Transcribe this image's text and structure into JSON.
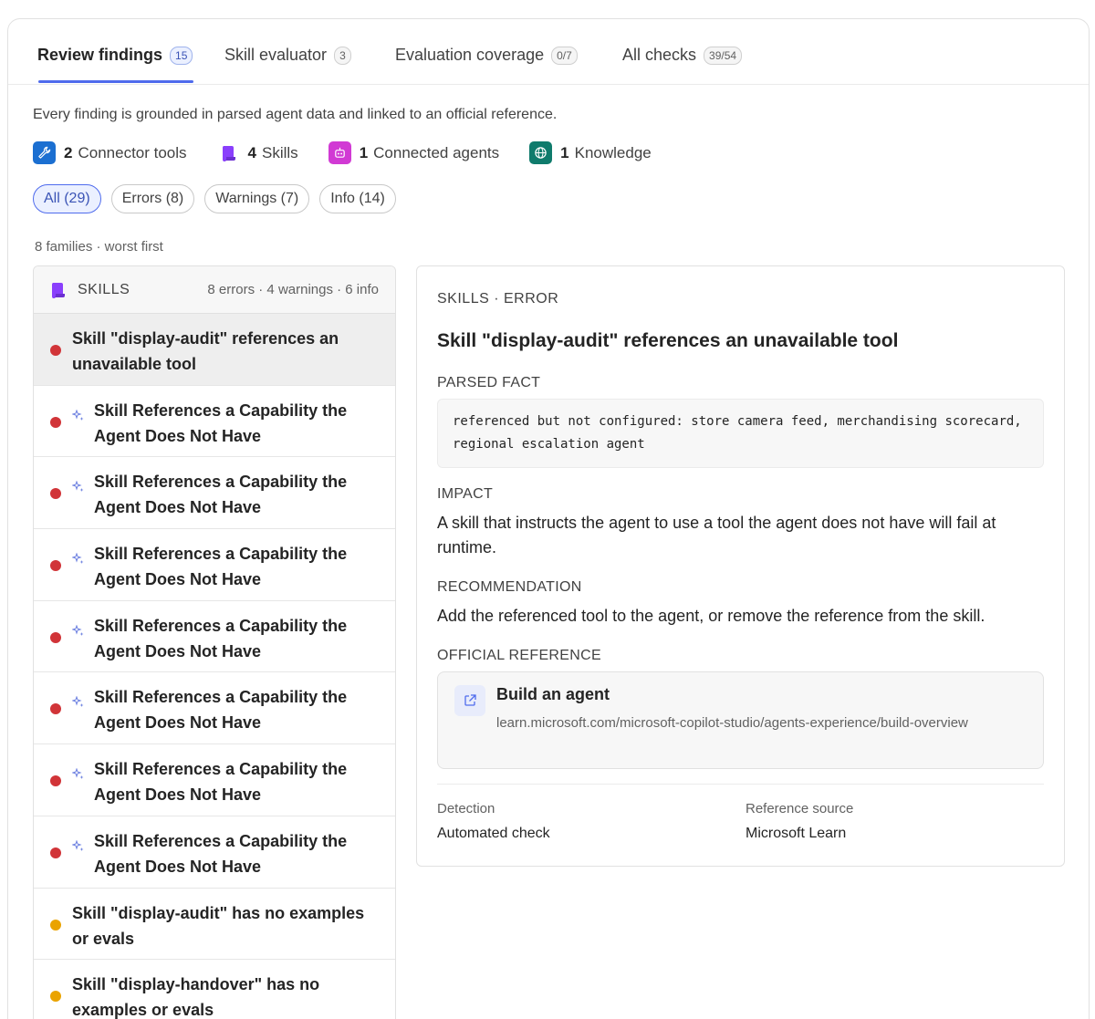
{
  "tabs": [
    {
      "label": "Review findings",
      "count": "15"
    },
    {
      "label": "Skill evaluator",
      "count": "3"
    },
    {
      "label": "Evaluation coverage",
      "count": "0/7"
    },
    {
      "label": "All checks",
      "count": "39/54"
    }
  ],
  "intro": "Every finding is grounded in parsed agent data and linked to an official reference.",
  "stats": [
    {
      "count": "2",
      "label": "Connector tools",
      "icon": "wrench-icon",
      "color": "#1b6fd1"
    },
    {
      "count": "4",
      "label": "Skills",
      "icon": "scroll-icon",
      "color": "#8a3ffc"
    },
    {
      "count": "1",
      "label": "Connected agents",
      "icon": "robot-icon",
      "color": "#d13ad4"
    },
    {
      "count": "1",
      "label": "Knowledge",
      "icon": "globe-icon",
      "color": "#0f7b6c"
    }
  ],
  "filters": [
    "All (29)",
    "Errors (8)",
    "Warnings (7)",
    "Info (14)"
  ],
  "families_note": "8 families · worst first",
  "left_panel": {
    "title": "SKILLS",
    "summary": "8 errors · 4 warnings · 6 info",
    "items": [
      {
        "title": "Skill \"display-audit\" references an unavailable tool",
        "severity": "error",
        "sparkle": false
      },
      {
        "title": "Skill References a Capability the Agent Does Not Have",
        "severity": "error",
        "sparkle": true
      },
      {
        "title": "Skill References a Capability the Agent Does Not Have",
        "severity": "error",
        "sparkle": true
      },
      {
        "title": "Skill References a Capability the Agent Does Not Have",
        "severity": "error",
        "sparkle": true
      },
      {
        "title": "Skill References a Capability the Agent Does Not Have",
        "severity": "error",
        "sparkle": true
      },
      {
        "title": "Skill References a Capability the Agent Does Not Have",
        "severity": "error",
        "sparkle": true
      },
      {
        "title": "Skill References a Capability the Agent Does Not Have",
        "severity": "error",
        "sparkle": true
      },
      {
        "title": "Skill References a Capability the Agent Does Not Have",
        "severity": "error",
        "sparkle": true
      },
      {
        "title": "Skill \"display-audit\" has no examples or evals",
        "severity": "warning",
        "sparkle": false
      },
      {
        "title": "Skill \"display-handover\" has no examples or evals",
        "severity": "warning",
        "sparkle": false
      }
    ]
  },
  "detail": {
    "kicker": "SKILLS · ERROR",
    "title": "Skill \"display-audit\" references an unavailable tool",
    "parsed_fact_label": "PARSED FACT",
    "parsed_fact": "referenced but not configured: store camera feed, merchandising scorecard, regional escalation agent",
    "impact_label": "IMPACT",
    "impact": "A skill that instructs the agent to use a tool the agent does not have will fail at runtime.",
    "recommendation_label": "RECOMMENDATION",
    "recommendation": "Add the referenced tool to the agent, or remove the reference from the skill.",
    "official_reference_label": "OFFICIAL REFERENCE",
    "reference_title": "Build an agent",
    "reference_url": "learn.microsoft.com/microsoft-copilot-studio/agents-experience/build-overview",
    "detection_label": "Detection",
    "detection_value": "Automated check",
    "source_label": "Reference source",
    "source_value": "Microsoft Learn"
  },
  "colors": {
    "accent": "#4f6bed",
    "error": "#d13438",
    "warning": "#eaa300",
    "skills_purple": "#8a3ffc"
  }
}
